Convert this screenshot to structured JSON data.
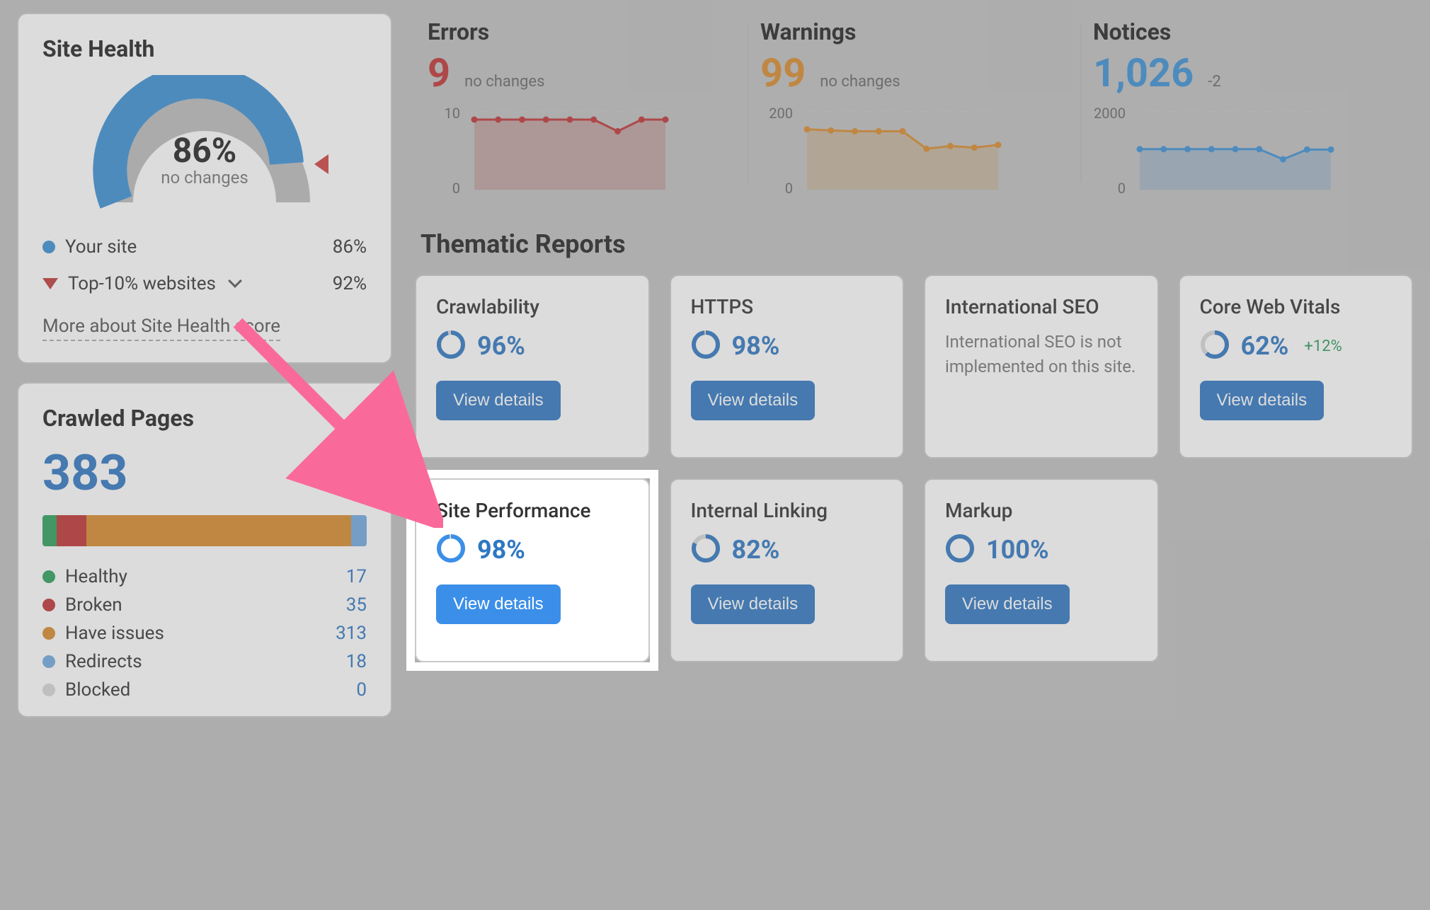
{
  "site_health": {
    "title": "Site Health",
    "percent_label": "86%",
    "sub_label": "no changes",
    "your_site_label": "Your site",
    "your_site_pct": "86%",
    "top10_label": "Top-10% websites",
    "top10_pct": "92%",
    "link": "More about Site Health score",
    "chart_data": {
      "type": "gauge",
      "value": 86,
      "comparison_marker": 92,
      "range": [
        0,
        100
      ]
    }
  },
  "crawled": {
    "title": "Crawled Pages",
    "total": "383",
    "segments": [
      {
        "label": "Healthy",
        "value": "17",
        "color": "#2aa05a"
      },
      {
        "label": "Broken",
        "value": "35",
        "color": "#c03333"
      },
      {
        "label": "Have issues",
        "value": "313",
        "color": "#d88a2c"
      },
      {
        "label": "Redirects",
        "value": "18",
        "color": "#6fa9df"
      },
      {
        "label": "Blocked",
        "value": "0",
        "color": "#d7d7d7"
      }
    ]
  },
  "metrics": {
    "errors": {
      "title": "Errors",
      "value": "9",
      "delta": "no changes",
      "color": "#c03333",
      "axis_top": "10",
      "axis_bot": "0",
      "chart_data": {
        "type": "area",
        "ylim": [
          0,
          10
        ],
        "values": [
          9,
          9,
          9,
          9,
          9,
          9,
          7.5,
          9,
          9
        ]
      }
    },
    "warnings": {
      "title": "Warnings",
      "value": "99",
      "delta": "no changes",
      "color": "#d88a2c",
      "axis_top": "200",
      "axis_bot": "0",
      "chart_data": {
        "type": "area",
        "ylim": [
          0,
          200
        ],
        "values": [
          155,
          152,
          150,
          150,
          150,
          105,
          112,
          108,
          115
        ]
      }
    },
    "notices": {
      "title": "Notices",
      "value": "1,026",
      "delta": "-2",
      "color": "#3b8fd4",
      "axis_top": "2000",
      "axis_bot": "0",
      "chart_data": {
        "type": "area",
        "ylim": [
          0,
          2000
        ],
        "values": [
          1040,
          1040,
          1040,
          1040,
          1040,
          1040,
          780,
          1030,
          1030
        ]
      }
    }
  },
  "thematic": {
    "title": "Thematic Reports",
    "btn": "View details",
    "cards": [
      {
        "title": "Crawlability",
        "pct": "96%",
        "ring": 96
      },
      {
        "title": "HTTPS",
        "pct": "98%",
        "ring": 98
      },
      {
        "title": "International SEO",
        "note": "International SEO is not implemented on this site."
      },
      {
        "title": "Core Web Vitals",
        "pct": "62%",
        "ring": 62,
        "delta": "+12%"
      },
      {
        "title": "Site Performance",
        "pct": "98%",
        "ring": 98,
        "highlight": true
      },
      {
        "title": "Internal Linking",
        "pct": "82%",
        "ring": 82
      },
      {
        "title": "Markup",
        "pct": "100%",
        "ring": 100
      }
    ]
  }
}
